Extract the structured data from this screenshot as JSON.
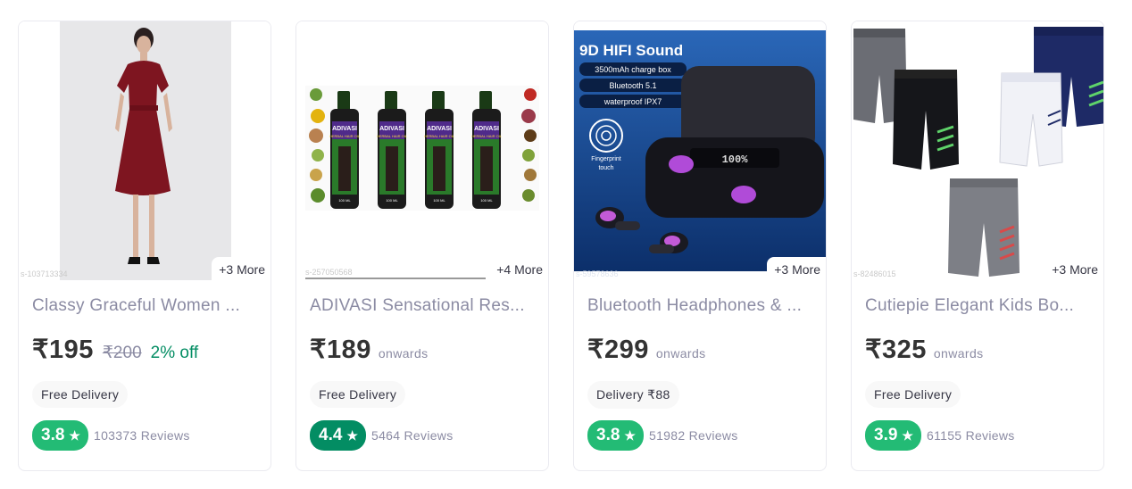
{
  "products": [
    {
      "sku": "s-103713334",
      "more": "+3 More",
      "title": "Classy Graceful Women ...",
      "price": "₹195",
      "mrp": "₹200",
      "discount": "2% off",
      "delivery": "Free Delivery",
      "rating": "3.8",
      "reviews": "103373 Reviews",
      "rating_color": "#23bb75"
    },
    {
      "sku": "s-257050568",
      "more": "+4 More",
      "title": "ADIVASI Sensational Res...",
      "price": "₹189",
      "onwards": "onwards",
      "delivery": "Free Delivery",
      "rating": "4.4",
      "reviews": "5464 Reviews",
      "rating_color": "#038d63",
      "image_labels": {
        "brand": "ADIVASI",
        "line": "HERBAL HAIR OIL",
        "volume": "100 ML"
      }
    },
    {
      "sku": "s-59578636",
      "more": "+3 More",
      "title": "Bluetooth Headphones & ...",
      "price": "₹299",
      "onwards": "onwards",
      "delivery": "Delivery ₹88",
      "rating": "3.8",
      "reviews": "51982 Reviews",
      "rating_color": "#23bb75",
      "image_labels": {
        "headline": "9D HIFI Sound",
        "spec1": "3500mAh charge box",
        "spec2": "Bluetooth 5.1",
        "spec3": "waterproof IPX7",
        "touch": "Fingerprint touch",
        "display": "100%"
      }
    },
    {
      "sku": "s-82486015",
      "more": "+3 More",
      "title": "Cutiepie Elegant Kids Bo...",
      "price": "₹325",
      "onwards": "onwards",
      "delivery": "Free Delivery",
      "rating": "3.9",
      "reviews": "61155 Reviews",
      "rating_color": "#23bb75"
    }
  ],
  "icons": {
    "rating": "star-icon"
  },
  "colors": {
    "rating_green": "#23bb75",
    "rating_dark_green": "#038d63",
    "discount_green": "#038d63"
  }
}
